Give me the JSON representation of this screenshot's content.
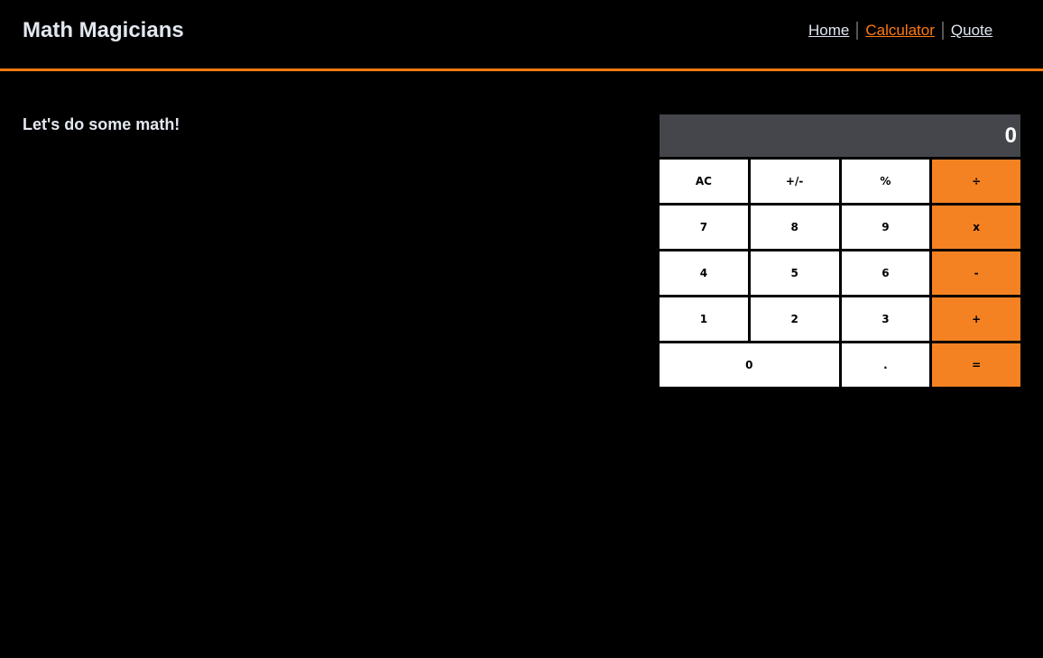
{
  "header": {
    "title": "Math Magicians",
    "nav": [
      {
        "label": "Home"
      },
      {
        "label": "Calculator",
        "active": true
      },
      {
        "label": "Quote"
      }
    ]
  },
  "main": {
    "heading": "Let's do some math!"
  },
  "calculator": {
    "display": "0",
    "buttons": [
      {
        "label": "AC"
      },
      {
        "label": "+/-"
      },
      {
        "label": "%"
      },
      {
        "label": "÷",
        "op": true
      },
      {
        "label": "7"
      },
      {
        "label": "8"
      },
      {
        "label": "9"
      },
      {
        "label": "x",
        "op": true
      },
      {
        "label": "4"
      },
      {
        "label": "5"
      },
      {
        "label": "6"
      },
      {
        "label": "-",
        "op": true
      },
      {
        "label": "1"
      },
      {
        "label": "2"
      },
      {
        "label": "3"
      },
      {
        "label": "+",
        "op": true
      },
      {
        "label": "0",
        "wide": true
      },
      {
        "label": "."
      },
      {
        "label": "=",
        "op": true
      }
    ]
  },
  "colors": {
    "accent": "#ff7a0f",
    "operator": "#f58222",
    "display_bg": "#45464b"
  }
}
